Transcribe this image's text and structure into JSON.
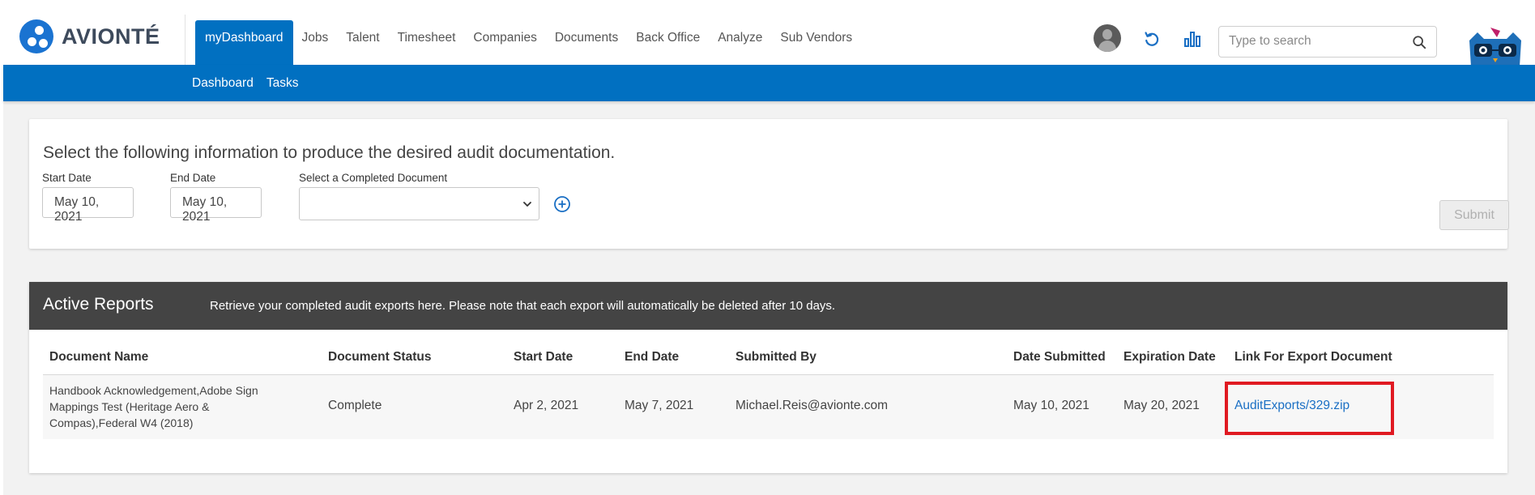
{
  "brand": {
    "name": "AVIONTÉ"
  },
  "nav": {
    "items": [
      "myDashboard",
      "Jobs",
      "Talent",
      "Timesheet",
      "Companies",
      "Documents",
      "Back Office",
      "Analyze",
      "Sub Vendors"
    ],
    "active": "myDashboard"
  },
  "subnav": {
    "items": [
      "Dashboard",
      "Tasks"
    ]
  },
  "search": {
    "placeholder": "Type to search",
    "value": ""
  },
  "icons": {
    "avatar": "user-avatar-icon",
    "refresh": "refresh-icon",
    "analytics": "bar-chart-icon",
    "search": "search-icon",
    "mascot": "owl-mascot-icon",
    "add": "add-circle-icon",
    "dropdown": "chevron-down-icon"
  },
  "colors": {
    "brand_blue": "#0170c1",
    "header_dark": "#444444",
    "highlight": "#e01a22",
    "link": "#1a6fc4"
  },
  "audit": {
    "title": "Select the following information to produce the desired audit documentation.",
    "start_label": "Start Date",
    "start_value": "May 10, 2021",
    "end_label": "End Date",
    "end_value": "May 10, 2021",
    "doc_label": "Select a Completed Document",
    "doc_value": "",
    "submit_label": "Submit"
  },
  "reports": {
    "title": "Active Reports",
    "note": "Retrieve your completed audit exports here. Please note that each export will automatically be deleted after 10 days.",
    "columns": [
      "Document Name",
      "Document Status",
      "Start Date",
      "End Date",
      "Submitted By",
      "Date Submitted",
      "Expiration Date",
      "Link For Export Document"
    ],
    "rows": [
      {
        "document_name": "Handbook Acknowledgement,Adobe Sign Mappings Test (Heritage Aero & Compas),Federal W4 (2018)",
        "status": "Complete",
        "start_date": "Apr 2, 2021",
        "end_date": "May 7, 2021",
        "submitted_by": "Michael.Reis@avionte.com",
        "date_submitted": "May 10, 2021",
        "expiration_date": "May 20, 2021",
        "link": "AuditExports/329.zip"
      }
    ]
  }
}
